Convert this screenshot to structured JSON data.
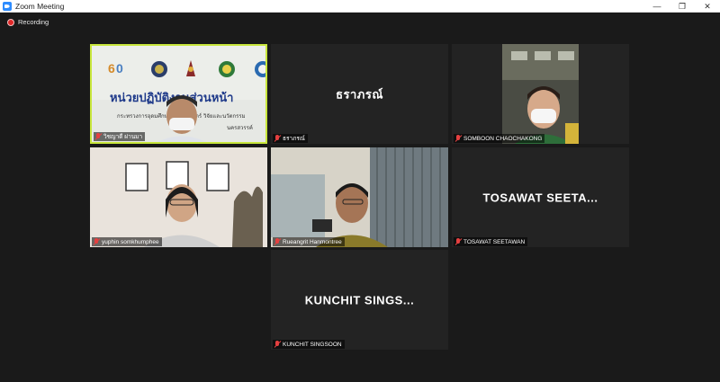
{
  "window": {
    "title": "Zoom Meeting",
    "minimize": "—",
    "restore": "❐",
    "close": "✕"
  },
  "recording": {
    "label": "Recording"
  },
  "participants": [
    {
      "name": "วิชญาดี ผ่านมา",
      "center_label": "",
      "video": true,
      "muted": true,
      "active_speaker": true,
      "banner_lines": [
        "หน่วยปฏิบัติงานส่วนหน้า",
        "กระทรวงการอุดมศึกษา วิทยาศาสตร์ วิจัยและนวัตกรรม",
        "นครสวรรค์"
      ]
    },
    {
      "name": "ธราภรณ์",
      "center_label": "ธราภรณ์",
      "video": false,
      "muted": true
    },
    {
      "name": "SOMBOON CHAOCHAKONG",
      "center_label": "",
      "video": true,
      "muted": true
    },
    {
      "name": "yuphin somkhumphee",
      "center_label": "",
      "video": true,
      "muted": true
    },
    {
      "name": "Rueangrit Hanmontree",
      "center_label": "",
      "video": true,
      "muted": true
    },
    {
      "name": "TOSAWAT SEETAWAN",
      "center_label": "TOSAWAT SEETA...",
      "video": false,
      "muted": true
    },
    {
      "name": "KUNCHIT SINGSOON",
      "center_label": "KUNCHIT SINGS...",
      "video": false,
      "muted": true
    }
  ],
  "colors": {
    "active_border": "#c8e63c",
    "muted_icon": "#e54040",
    "recording_dot": "#e02828",
    "tile_bg": "#232323",
    "app_accent": "#2D8CFF"
  }
}
